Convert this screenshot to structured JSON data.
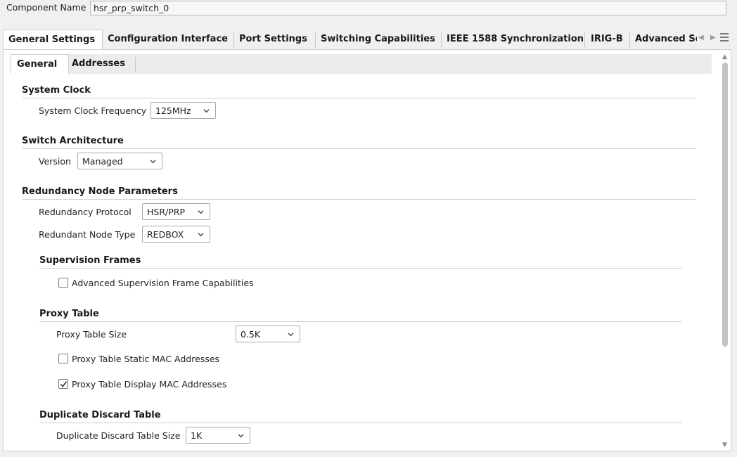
{
  "component": {
    "label": "Component Name",
    "value": "hsr_prp_switch_0"
  },
  "outer_tabs": [
    {
      "label": "General Settings"
    },
    {
      "label": "Configuration Interface"
    },
    {
      "label": "Port Settings"
    },
    {
      "label": "Switching Capabilities"
    },
    {
      "label": "IEEE 1588 Synchronization"
    },
    {
      "label": "IRIG-B"
    },
    {
      "label": "Advanced Se"
    }
  ],
  "inner_tabs": [
    {
      "label": "General"
    },
    {
      "label": "Addresses"
    }
  ],
  "system_clock": {
    "title": "System Clock",
    "freq_label": "System Clock Frequency",
    "freq_value": "125MHz"
  },
  "switch_architecture": {
    "title": "Switch Architecture",
    "version_label": "Version",
    "version_value": "Managed"
  },
  "redundancy": {
    "title": "Redundancy Node Parameters",
    "protocol_label": "Redundancy Protocol",
    "protocol_value": "HSR/PRP",
    "node_type_label": "Redundant Node Type",
    "node_type_value": "REDBOX"
  },
  "supervision_frames": {
    "title": "Supervision Frames",
    "adv_label": "Advanced Supervision Frame Capabilities",
    "adv_checked": false
  },
  "proxy_table": {
    "title": "Proxy Table",
    "size_label": "Proxy Table Size",
    "size_value": "0.5K",
    "static_label": "Proxy Table Static MAC Addresses",
    "static_checked": false,
    "display_label": "Proxy Table Display MAC Addresses",
    "display_checked": true
  },
  "duplicate_discard": {
    "title": "Duplicate Discard Table",
    "size_label": "Duplicate Discard Table Size",
    "size_value": "1K"
  }
}
